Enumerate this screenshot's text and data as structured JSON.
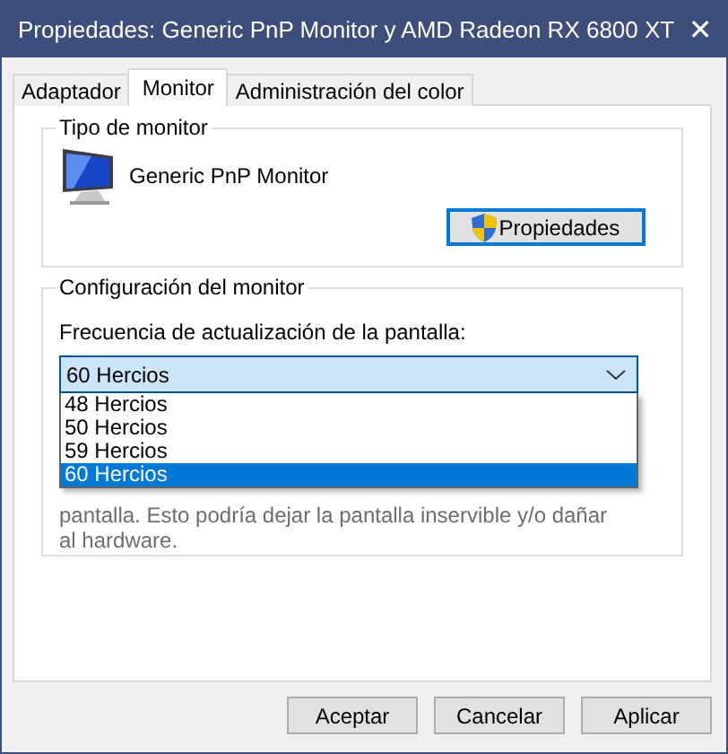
{
  "window": {
    "title": "Propiedades: Generic PnP Monitor y AMD Radeon RX 6800 XT",
    "close": "✕"
  },
  "tabs": [
    {
      "label": "Adaptador",
      "selected": false
    },
    {
      "label": "Monitor",
      "selected": true
    },
    {
      "label": "Administración del color",
      "selected": false
    }
  ],
  "monitor_type": {
    "heading": "Tipo de monitor",
    "name": "Generic PnP Monitor",
    "button": "Propiedades"
  },
  "monitor_settings": {
    "heading": "Configuración del monitor",
    "refresh_label": "Frecuencia de actualización de la pantalla:",
    "refresh_value": "60 Hercios",
    "expanded": true,
    "options": [
      {
        "label": "48 Hercios",
        "selected": false
      },
      {
        "label": "50 Hercios",
        "selected": false
      },
      {
        "label": "59 Hercios",
        "selected": false
      },
      {
        "label": "60 Hercios",
        "selected": true
      }
    ],
    "warning": "pantalla. Esto podría dejar la pantalla inservible y/o dañar al hardware."
  },
  "buttons": [
    "Aceptar",
    "Cancelar",
    "Aplicar"
  ]
}
